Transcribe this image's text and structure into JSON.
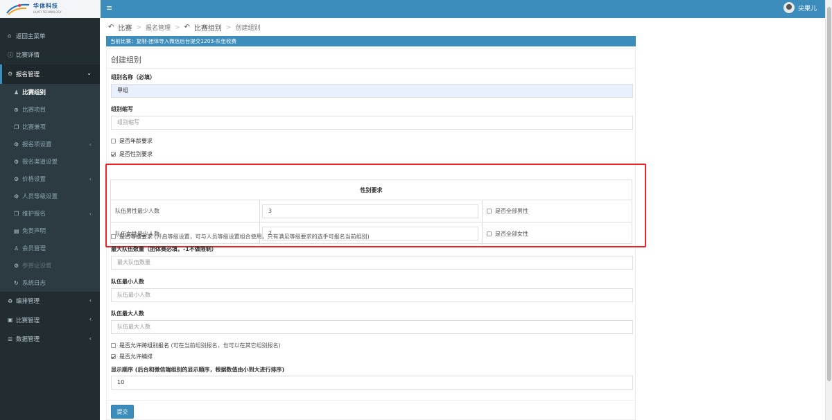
{
  "brand": {
    "name": "华体科技",
    "sub": "HUATI TECHNOLOGY"
  },
  "header": {
    "menu_icon": "≡",
    "user_name": "尖果儿"
  },
  "sidebar": {
    "items": [
      {
        "icon": "home-icon",
        "glyph": "⌂",
        "label": "返回主菜单"
      },
      {
        "icon": "info-icon",
        "glyph": "ⓘ",
        "label": "比赛详情"
      },
      {
        "icon": "cogs-icon",
        "glyph": "⚙",
        "label": "报名管理",
        "arrow": "⌄"
      }
    ],
    "sub_items": [
      {
        "glyph": "♟",
        "label": "比赛组别"
      },
      {
        "glyph": "⊛",
        "label": "比赛项目"
      },
      {
        "glyph": "❐",
        "label": "比赛兼项"
      },
      {
        "glyph": "⚙",
        "label": "报名项设置",
        "arrow": "‹"
      },
      {
        "glyph": "⚙",
        "label": "报名渠道设置"
      },
      {
        "glyph": "⚙",
        "label": "价格设置",
        "arrow": "‹"
      },
      {
        "glyph": "⚙",
        "label": "人员等级设置"
      },
      {
        "glyph": "❐",
        "label": "维护报名",
        "arrow": "‹"
      },
      {
        "glyph": "▤",
        "label": "免责声明"
      },
      {
        "glyph": "♙",
        "label": "会员管理"
      },
      {
        "glyph": "⚙",
        "label": "参赛证设置"
      },
      {
        "glyph": "↻",
        "label": "系统日志"
      }
    ],
    "bottom_items": [
      {
        "glyph": "♻",
        "label": "编排管理",
        "arrow": "‹"
      },
      {
        "glyph": "▣",
        "label": "比赛管理",
        "arrow": "‹"
      },
      {
        "glyph": "☰",
        "label": "数据管理",
        "arrow": "‹"
      }
    ]
  },
  "breadcrumb": {
    "back1": "比赛",
    "item2": "报名管理",
    "back3": "比赛组别",
    "item4": "创建组别",
    "sep": ">"
  },
  "banner": "当前比赛：复制-团体导入微信后台提交1203-队伍收费",
  "form": {
    "title": "创建组别",
    "name_label": "组别名称（必填）",
    "name_value": "甲组",
    "abbr_label": "组别缩写",
    "abbr_placeholder": "组别缩写",
    "age_req": "是否年龄要求",
    "gender_req": "是否性别要求",
    "gender_table": {
      "header": "性别要求",
      "rows": [
        {
          "label": "队伍男性最少人数",
          "value": "3",
          "check": "是否全部男性"
        },
        {
          "label": "队伍女性最少人数",
          "value": "2",
          "check": "是否全部女性"
        }
      ]
    },
    "level_req": "是否等级要求",
    "level_note": "(开启等级设置，可与人员等级设置组合使用，只有满足等级要求的选手可报名当前组别)",
    "max_teams_label": "最大队伍数量（团体赛必填，-1不做限制）",
    "max_teams_placeholder": "最大队伍数量",
    "min_members_label": "队伍最小人数",
    "min_members_placeholder": "队伍最小人数",
    "max_members_label": "队伍最大人数",
    "max_members_placeholder": "队伍最大人数",
    "cross_label": "是否允许跨组别报名",
    "cross_note": "(可在当前组别报名，也可以在其它组别报名)",
    "arrange_label": "是否允许编排",
    "order_label": "显示顺序 (后台和微信端组别的显示顺序，根据数值由小到大进行排序)",
    "order_value": "10",
    "submit": "提交"
  }
}
